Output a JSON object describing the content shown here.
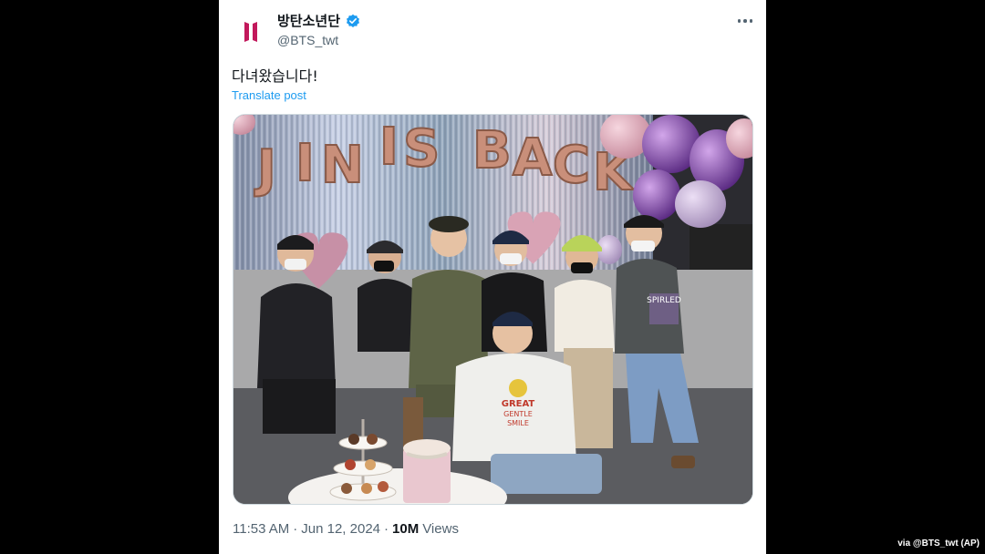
{
  "tweet": {
    "display_name": "방탄소년단",
    "handle": "@BTS_twt",
    "verified": true,
    "text": "다녀왔습니다!",
    "translate_label": "Translate post",
    "time": "11:53 AM",
    "separator": "·",
    "date": "Jun 12, 2024",
    "views_count": "10M",
    "views_label": "Views",
    "more_icon": "more-horizontal-icon",
    "verified_icon": "verified-badge-icon",
    "accent_color": "#1d9bf0"
  },
  "photo": {
    "banner_letters": [
      "J",
      "I",
      "N",
      "I",
      "S",
      "B",
      "A",
      "C",
      "K"
    ],
    "shirt_text": [
      "GREAT",
      "GENTLE",
      "SMILE"
    ],
    "tshirt_text": "SPIRLED"
  },
  "credit": "via @BTS_twt (AP)"
}
